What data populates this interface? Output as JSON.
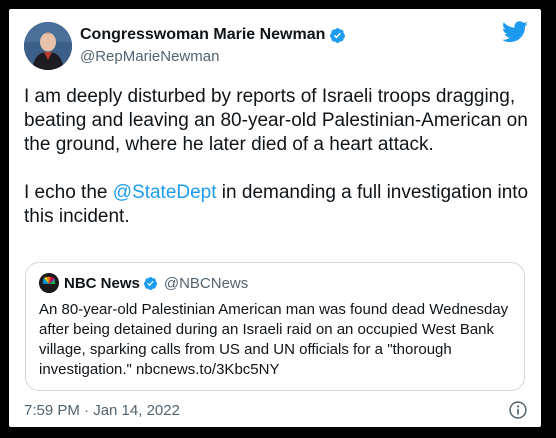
{
  "author": {
    "name": "Congresswoman Marie Newman",
    "handle": "@RepMarieNewman"
  },
  "tweet": {
    "paragraph1": "I am deeply disturbed by reports of Israeli troops dragging, beating and leaving an 80-year-old Palestinian-American on the ground, where he later died of a heart attack.",
    "paragraph2_before": "I echo the ",
    "paragraph2_mention": "@StateDept",
    "paragraph2_after": " in demanding a full investigation into this incident."
  },
  "quote": {
    "name": "NBC News",
    "handle": "@NBCNews",
    "text": "An 80-year-old Palestinian American man was found dead Wednesday after being detained during an Israeli raid on an occupied West Bank village, sparking calls from US and UN officials for a \"thorough investigation.\" nbcnews.to/3Kbc5NY"
  },
  "meta": {
    "timestamp": "7:59 PM · Jan 14, 2022"
  },
  "icons": {
    "verified": "verified-badge-icon",
    "twitter": "twitter-bird-icon",
    "info": "info-icon"
  },
  "colors": {
    "accent": "#1d9bf0",
    "text": "#0f1419",
    "secondary": "#536471",
    "border": "#cfd9de"
  }
}
